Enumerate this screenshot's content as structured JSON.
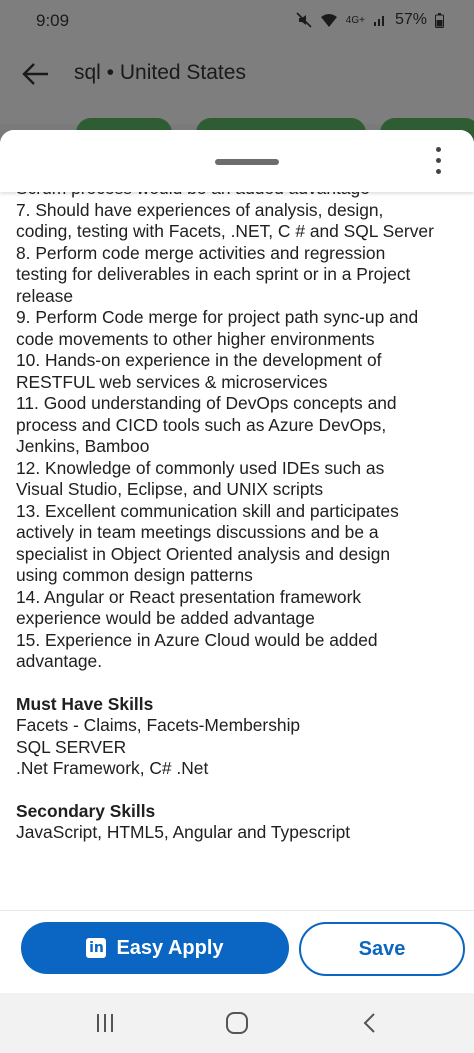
{
  "status_bar": {
    "time": "9:09",
    "icons_text": "4G+",
    "battery": "57%"
  },
  "app_bar": {
    "title": "sql • United States"
  },
  "description_lines": [
    "Scrum process would be an added advantage",
    " 7. Should have experiences of analysis, design,",
    "coding, testing with Facets, .NET, C # and SQL Server",
    " 8. Perform code merge activities and regression",
    "testing for deliverables in each sprint or in a Project",
    "release",
    " 9. Perform Code merge for project path sync-up and",
    "code movements to other higher environments",
    " 10. Hands-on experience in the development of",
    "RESTFUL web services & microservices",
    " 11. Good understanding of DevOps concepts and",
    "process and CICD tools such as Azure DevOps,",
    "Jenkins, Bamboo",
    " 12. Knowledge of commonly used IDEs such as",
    "Visual Studio, Eclipse, and UNIX scripts",
    " 13. Excellent communication skill and participates",
    "actively in team meetings discussions and be a",
    "specialist in Object Oriented analysis and design",
    "using common design patterns",
    " 14. Angular or React presentation framework",
    "experience would be added advantage",
    " 15. Experience in Azure Cloud would be added",
    "advantage."
  ],
  "must_have": {
    "heading": "Must Have Skills",
    "items": [
      "Facets - Claims, Facets-Membership",
      "SQL SERVER",
      ".Net Framework, C# .Net"
    ]
  },
  "secondary": {
    "heading": "Secondary Skills",
    "items": [
      "JavaScript, HTML5, Angular and Typescript"
    ]
  },
  "footer": {
    "easy_apply_label": "Easy Apply",
    "linkedin_glyph": "in",
    "save_label": "Save"
  },
  "colors": {
    "accent": "#0a66c2"
  }
}
